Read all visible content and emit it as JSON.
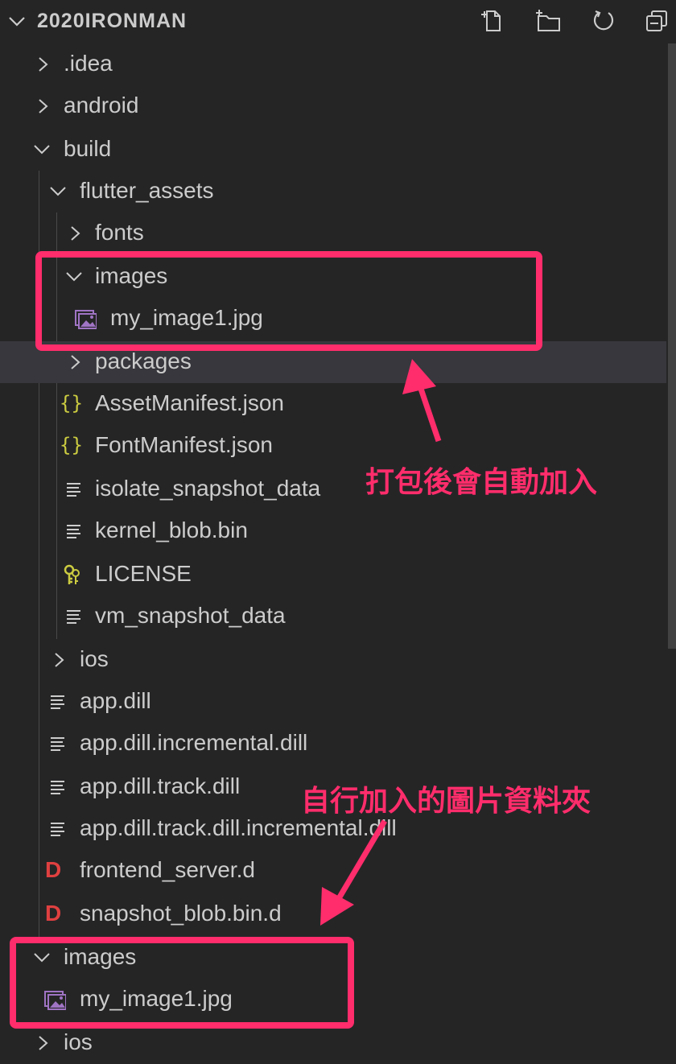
{
  "header": {
    "title": "2020IRONMAN"
  },
  "tree": [
    {
      "label": ".idea",
      "kind": "folder-closed"
    },
    {
      "label": "android",
      "kind": "folder-closed"
    },
    {
      "label": "build",
      "kind": "folder-open"
    },
    {
      "label": "flutter_assets",
      "kind": "folder-open"
    },
    {
      "label": "fonts",
      "kind": "folder-closed"
    },
    {
      "label": "images",
      "kind": "folder-open"
    },
    {
      "label": "my_image1.jpg",
      "kind": "image-file"
    },
    {
      "label": "packages",
      "kind": "folder-closed"
    },
    {
      "label": "AssetManifest.json",
      "kind": "json-file"
    },
    {
      "label": "FontManifest.json",
      "kind": "json-file"
    },
    {
      "label": "isolate_snapshot_data",
      "kind": "text-file"
    },
    {
      "label": "kernel_blob.bin",
      "kind": "text-file"
    },
    {
      "label": "LICENSE",
      "kind": "license-file"
    },
    {
      "label": "vm_snapshot_data",
      "kind": "text-file"
    },
    {
      "label": "ios",
      "kind": "folder-closed"
    },
    {
      "label": "app.dill",
      "kind": "text-file"
    },
    {
      "label": "app.dill.incremental.dill",
      "kind": "text-file"
    },
    {
      "label": "app.dill.track.dill",
      "kind": "text-file"
    },
    {
      "label": "app.dill.track.dill.incremental.dill",
      "kind": "text-file"
    },
    {
      "label": "frontend_server.d",
      "kind": "d-file"
    },
    {
      "label": "snapshot_blob.bin.d",
      "kind": "d-file"
    },
    {
      "label": "images",
      "kind": "folder-open"
    },
    {
      "label": "my_image1.jpg",
      "kind": "image-file"
    },
    {
      "label": "ios",
      "kind": "folder-closed"
    }
  ],
  "annotations": {
    "auto_added": "打包後會自動加入",
    "manual_folder": "自行加入的圖片資料夾"
  },
  "colors": {
    "sidebar_bg": "#252526",
    "hover_row": "#37373d",
    "highlight": "#ff2d6b",
    "image_icon": "#a074c4",
    "json_icon": "#cbcb41",
    "d_icon": "#e04040"
  }
}
